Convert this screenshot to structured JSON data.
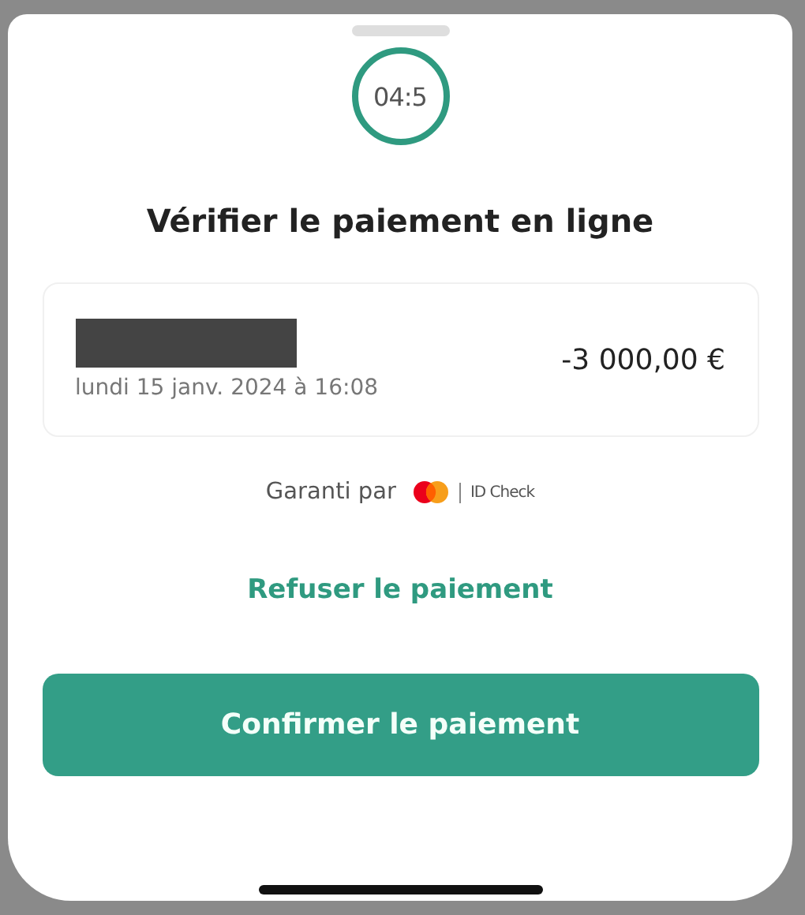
{
  "timer": "04:5",
  "title": "Vérifier le paiement en ligne",
  "transaction": {
    "date": "lundi 15 janv. 2024 à 16:08",
    "amount": "-3 000,00 €"
  },
  "guarantee": {
    "label": "Garanti par",
    "brand": "ID Check"
  },
  "refuse_link": "Refuser le paiement",
  "confirm_button": "Confirmer le paiement"
}
